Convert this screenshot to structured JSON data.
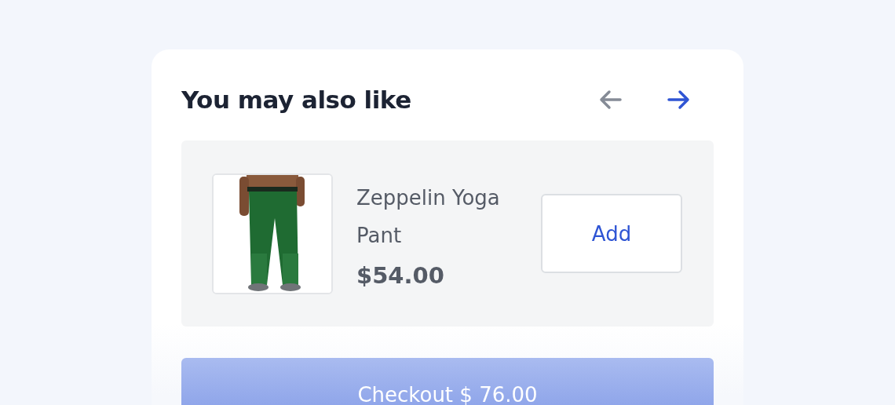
{
  "title": "You may also like",
  "nav": [
    {
      "kind": "prev",
      "disabled": true
    },
    {
      "kind": "next",
      "disabled": false
    }
  ],
  "product": {
    "name": "Zeppelin Yoga Pant",
    "price": "$54.00",
    "button": "Add"
  },
  "checkout": {
    "label": "Checkout $ 76.00"
  }
}
